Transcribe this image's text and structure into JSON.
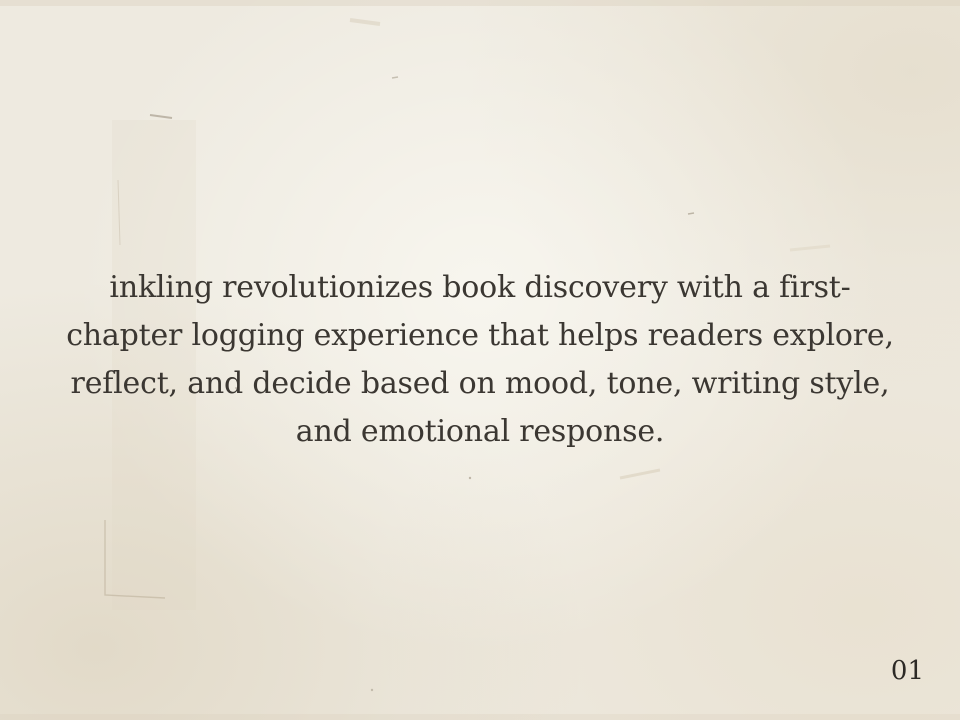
{
  "slide": {
    "body": "inkling revolutionizes book discovery with a first-chapter logging experience that helps readers explore, reflect, and decide based on mood, tone, writing style, and emotional response.",
    "page_number": "01"
  },
  "colors": {
    "paper": "#eeeae0",
    "text": "#3b3732"
  }
}
